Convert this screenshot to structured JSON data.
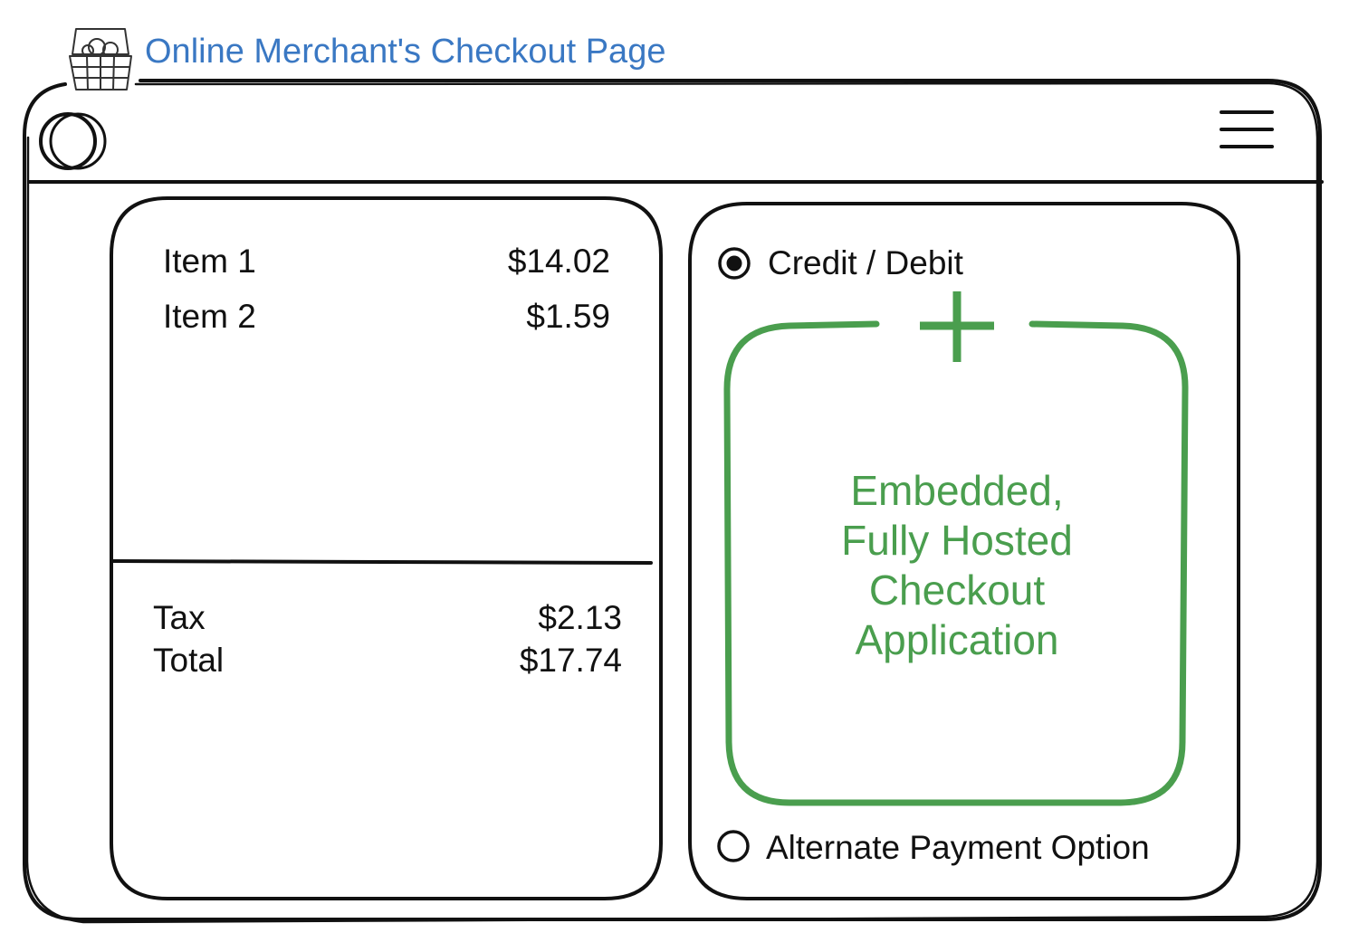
{
  "page": {
    "title": "Online Merchant's Checkout Page"
  },
  "icons": {
    "cart": "shopping-basket-icon",
    "avatar": "circle-logo-icon",
    "menu": "hamburger-menu-icon",
    "add": "plus-icon"
  },
  "order_summary": {
    "items": [
      {
        "label": "Item 1",
        "price": "$14.02"
      },
      {
        "label": "Item 2",
        "price": "$1.59"
      }
    ],
    "tax": {
      "label": "Tax",
      "amount": "$2.13"
    },
    "total": {
      "label": "Total",
      "amount": "$17.74"
    }
  },
  "payment": {
    "options": [
      {
        "label": "Credit / Debit",
        "selected": true
      },
      {
        "label": "Alternate Payment Option",
        "selected": false
      }
    ],
    "embedded_app": {
      "lines": [
        "Embedded,",
        "Fully Hosted",
        "Checkout",
        "Application"
      ]
    }
  },
  "colors": {
    "title": "#3a78c3",
    "embedded": "#4a9e4e",
    "stroke": "#111111"
  }
}
